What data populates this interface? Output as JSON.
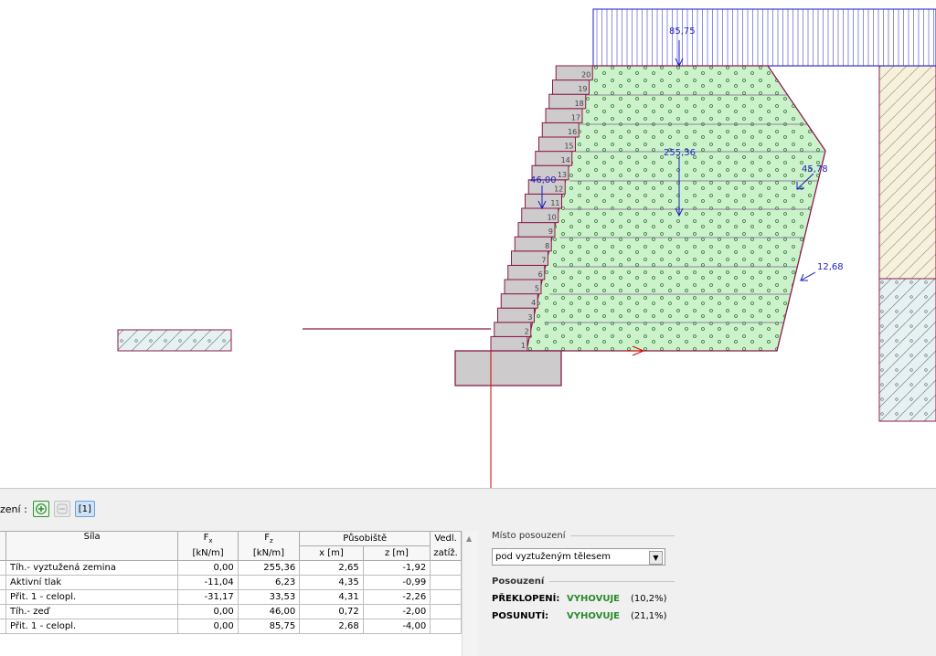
{
  "canvas": {
    "top_load_value": "85,75",
    "soil_weight_value": "255,36",
    "wall_weight_value": "46,00",
    "earth_pressure_value": "45,78",
    "surcharge_pressure_value": "12,68",
    "block_numbers": [
      "1",
      "2",
      "3",
      "4",
      "5",
      "6",
      "7",
      "8",
      "9",
      "10",
      "11",
      "12",
      "13",
      "14",
      "15",
      "16",
      "17",
      "18",
      "19",
      "20"
    ],
    "colors": {
      "reinforced_soil": "#ccf2cc",
      "outline": "#8b1a4a",
      "force": "#1c1cc8",
      "wall_block": "#cdcbcb"
    }
  },
  "toolbar": {
    "label": "zení :",
    "selected_item": "[1]",
    "icons": [
      "add-icon",
      "remove-icon"
    ]
  },
  "table": {
    "headers": {
      "force": "Síla",
      "fx": "F",
      "fx_sub": "x",
      "fx_unit": "[kN/m]",
      "fz": "F",
      "fz_sub": "z",
      "fz_unit": "[kN/m]",
      "point": "Působiště",
      "x": "x [m]",
      "z": "z [m]",
      "side": "Vedl.",
      "side2": "zatíž."
    },
    "rows": [
      {
        "name": "Tíh.- vyztužená zemina",
        "fx": "0,00",
        "fz": "255,36",
        "x": "2,65",
        "z": "-1,92",
        "side": ""
      },
      {
        "name": "Aktivní tlak",
        "fx": "-11,04",
        "fz": "6,23",
        "x": "4,35",
        "z": "-0,99",
        "side": ""
      },
      {
        "name": "Přit. 1 - celopl.",
        "fx": "-31,17",
        "fz": "33,53",
        "x": "4,31",
        "z": "-2,26",
        "side": ""
      },
      {
        "name": "Tíh.- zeď",
        "fx": "0,00",
        "fz": "46,00",
        "x": "0,72",
        "z": "-2,00",
        "side": ""
      },
      {
        "name": "Přit. 1 - celopl.",
        "fx": "0,00",
        "fz": "85,75",
        "x": "2,68",
        "z": "-4,00",
        "side": ""
      }
    ]
  },
  "panel": {
    "location_title": "Místo posouzení",
    "location_value": "pod vyztuženým tělesem",
    "assessment_title": "Posouzení",
    "results": [
      {
        "key": "PŘEKLOPENÍ:",
        "status": "VYHOVUJE",
        "pct": "(10,2%)"
      },
      {
        "key": "POSUNUTÍ:",
        "status": "VYHOVUJE",
        "pct": "(21,1%)"
      }
    ]
  }
}
